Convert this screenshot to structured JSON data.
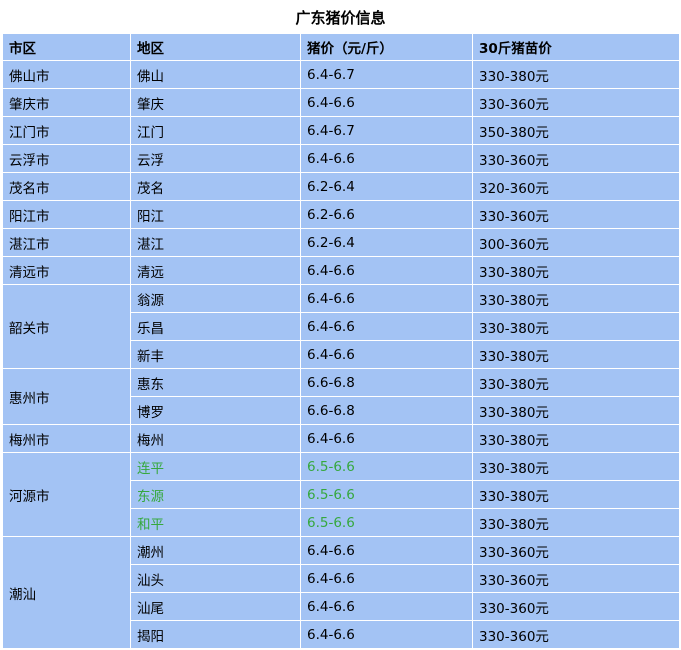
{
  "title": "广东猪价信息",
  "headers": [
    "市区",
    "地区",
    "猪价（元/斤）",
    "30斤猪苗价"
  ],
  "groups": [
    {
      "city": "佛山市",
      "rows": [
        {
          "area": "佛山",
          "price": "6.4-6.7",
          "piglet": "330-380元",
          "highlight": false
        }
      ]
    },
    {
      "city": "肇庆市",
      "rows": [
        {
          "area": "肇庆",
          "price": "6.4-6.6",
          "piglet": "330-360元",
          "highlight": false
        }
      ]
    },
    {
      "city": "江门市",
      "rows": [
        {
          "area": "江门",
          "price": "6.4-6.7",
          "piglet": "350-380元",
          "highlight": false
        }
      ]
    },
    {
      "city": "云浮市",
      "rows": [
        {
          "area": "云浮",
          "price": "6.4-6.6",
          "piglet": "330-360元",
          "highlight": false
        }
      ]
    },
    {
      "city": "茂名市",
      "rows": [
        {
          "area": "茂名",
          "price": "6.2-6.4",
          "piglet": "320-360元",
          "highlight": false
        }
      ]
    },
    {
      "city": "阳江市",
      "rows": [
        {
          "area": "阳江",
          "price": "6.2-6.6",
          "piglet": "330-360元",
          "highlight": false
        }
      ]
    },
    {
      "city": "湛江市",
      "rows": [
        {
          "area": "湛江",
          "price": "6.2-6.4",
          "piglet": "300-360元",
          "highlight": false
        }
      ]
    },
    {
      "city": "清远市",
      "rows": [
        {
          "area": "清远",
          "price": "6.4-6.6",
          "piglet": "330-380元",
          "highlight": false
        }
      ]
    },
    {
      "city": "韶关市",
      "rows": [
        {
          "area": "翁源",
          "price": "6.4-6.6",
          "piglet": "330-380元",
          "highlight": false
        },
        {
          "area": "乐昌",
          "price": "6.4-6.6",
          "piglet": "330-380元",
          "highlight": false
        },
        {
          "area": "新丰",
          "price": "6.4-6.6",
          "piglet": "330-380元",
          "highlight": false
        }
      ]
    },
    {
      "city": "惠州市",
      "rows": [
        {
          "area": "惠东",
          "price": "6.6-6.8",
          "piglet": "330-380元",
          "highlight": false
        },
        {
          "area": "博罗",
          "price": "6.6-6.8",
          "piglet": "330-380元",
          "highlight": false
        }
      ]
    },
    {
      "city": "梅州市",
      "rows": [
        {
          "area": "梅州",
          "price": "6.4-6.6",
          "piglet": "330-380元",
          "highlight": false
        }
      ]
    },
    {
      "city": "河源市",
      "rows": [
        {
          "area": "连平",
          "price": "6.5-6.6",
          "piglet": "330-380元",
          "highlight": true
        },
        {
          "area": "东源",
          "price": "6.5-6.6",
          "piglet": "330-380元",
          "highlight": true
        },
        {
          "area": "和平",
          "price": "6.5-6.6",
          "piglet": "330-380元",
          "highlight": true
        }
      ]
    },
    {
      "city": "潮汕",
      "rows": [
        {
          "area": "潮州",
          "price": "6.4-6.6",
          "piglet": "330-360元",
          "highlight": false
        },
        {
          "area": "汕头",
          "price": "6.4-6.6",
          "piglet": "330-360元",
          "highlight": false
        },
        {
          "area": "汕尾",
          "price": "6.4-6.6",
          "piglet": "330-360元",
          "highlight": false
        },
        {
          "area": "揭阳",
          "price": "6.4-6.6",
          "piglet": "330-360元",
          "highlight": false
        }
      ]
    }
  ],
  "colors": {
    "cell_bg": "#a3c3f4",
    "highlight_text": "#36a83e"
  }
}
